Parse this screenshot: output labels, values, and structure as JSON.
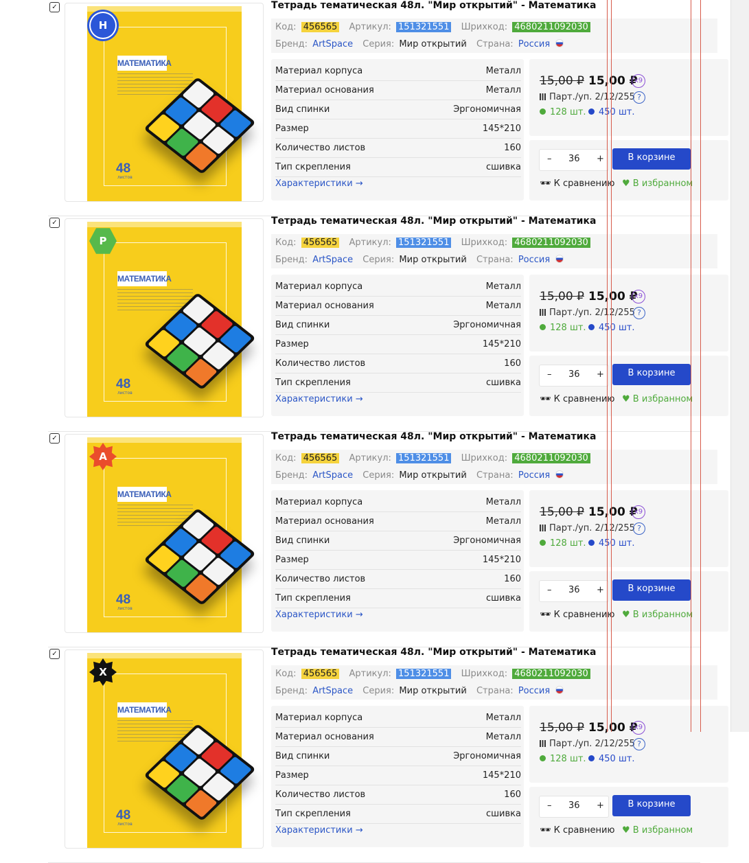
{
  "products": [
    {
      "badge": "Н",
      "badge_shape": "circle",
      "title": "Тетрадь тематическая 48л. \"Мир открытий\" - Математика",
      "code_label": "Код:",
      "code": "456565",
      "article_label": "Артикул:",
      "article": "151321551",
      "barcode_label": "Шрихкод:",
      "barcode": "4680211092030",
      "brand_label": "Бренд:",
      "brand": "ArtSpace",
      "series_label": "Серия:",
      "series": "Мир открытий",
      "country_label": "Страна:",
      "country": "Россия",
      "specs": [
        {
          "name": "Материал корпуса",
          "value": "Металл"
        },
        {
          "name": "Материал основания",
          "value": "Металл"
        },
        {
          "name": "Вид спинки",
          "value": "Эргономичная"
        },
        {
          "name": "Размер",
          "value": "145*210"
        },
        {
          "name": "Количество листов",
          "value": "160"
        },
        {
          "name": "Тип скрепления",
          "value": "сшивка"
        }
      ],
      "specs_link": "Характеристики →",
      "old_price": "15,00 ₽",
      "new_price": "15,00 ₽",
      "multiplier": "x9",
      "party": "Парт./уп. 2/12/255",
      "help": "?",
      "stock_green": "128 шт.",
      "stock_blue": "450 шт.",
      "qty": "36",
      "minus": "–",
      "plus": "+",
      "cart": "В корзине",
      "compare": "К сравнению",
      "favorite": "В избранном"
    },
    {
      "badge": "Р",
      "badge_shape": "hex",
      "title": "Тетрадь тематическая 48л. \"Мир открытий\" - Математика",
      "code_label": "Код:",
      "code": "456565",
      "article_label": "Артикул:",
      "article": "151321551",
      "barcode_label": "Шрихкод:",
      "barcode": "4680211092030",
      "brand_label": "Бренд:",
      "brand": "ArtSpace",
      "series_label": "Серия:",
      "series": "Мир открытий",
      "country_label": "Страна:",
      "country": "Россия",
      "specs": [
        {
          "name": "Материал корпуса",
          "value": "Металл"
        },
        {
          "name": "Материал основания",
          "value": "Металл"
        },
        {
          "name": "Вид спинки",
          "value": "Эргономичная"
        },
        {
          "name": "Размер",
          "value": "145*210"
        },
        {
          "name": "Количество листов",
          "value": "160"
        },
        {
          "name": "Тип скрепления",
          "value": "сшивка"
        }
      ],
      "specs_link": "Характеристики →",
      "old_price": "15,00 ₽",
      "new_price": "15,00 ₽",
      "multiplier": "x9",
      "party": "Парт./уп. 2/12/255",
      "help": "?",
      "stock_green": "128 шт.",
      "stock_blue": "450 шт.",
      "qty": "36",
      "minus": "–",
      "plus": "+",
      "cart": "В корзине",
      "compare": "К сравнению",
      "favorite": "В избранном"
    },
    {
      "badge": "А",
      "badge_shape": "star",
      "title": "Тетрадь тематическая 48л. \"Мир открытий\" - Математика",
      "code_label": "Код:",
      "code": "456565",
      "article_label": "Артикул:",
      "article": "151321551",
      "barcode_label": "Шрихкод:",
      "barcode": "4680211092030",
      "brand_label": "Бренд:",
      "brand": "ArtSpace",
      "series_label": "Серия:",
      "series": "Мир открытий",
      "country_label": "Страна:",
      "country": "Россия",
      "specs": [
        {
          "name": "Материал корпуса",
          "value": "Металл"
        },
        {
          "name": "Материал основания",
          "value": "Металл"
        },
        {
          "name": "Вид спинки",
          "value": "Эргономичная"
        },
        {
          "name": "Размер",
          "value": "145*210"
        },
        {
          "name": "Количество листов",
          "value": "160"
        },
        {
          "name": "Тип скрепления",
          "value": "сшивка"
        }
      ],
      "specs_link": "Характеристики →",
      "old_price": "15,00 ₽",
      "new_price": "15,00 ₽",
      "multiplier": "x9",
      "party": "Парт./уп. 2/12/255",
      "help": "?",
      "stock_green": "128 шт.",
      "stock_blue": "450 шт.",
      "qty": "36",
      "minus": "–",
      "plus": "+",
      "cart": "В корзине",
      "compare": "К сравнению",
      "favorite": "В избранном"
    },
    {
      "badge": "Х",
      "badge_shape": "black",
      "title": "Тетрадь тематическая 48л. \"Мир открытий\" - Математика",
      "code_label": "Код:",
      "code": "456565",
      "article_label": "Артикул:",
      "article": "151321551",
      "barcode_label": "Шрихкод:",
      "barcode": "4680211092030",
      "brand_label": "Бренд:",
      "brand": "ArtSpace",
      "series_label": "Серия:",
      "series": "Мир открытий",
      "country_label": "Страна:",
      "country": "Россия",
      "specs": [
        {
          "name": "Материал корпуса",
          "value": "Металл"
        },
        {
          "name": "Материал основания",
          "value": "Металл"
        },
        {
          "name": "Вид спинки",
          "value": "Эргономичная"
        },
        {
          "name": "Размер",
          "value": "145*210"
        },
        {
          "name": "Количество листов",
          "value": "160"
        },
        {
          "name": "Тип скрепления",
          "value": "сшивка"
        }
      ],
      "specs_link": "Характеристики →",
      "old_price": "15,00 ₽",
      "new_price": "15,00 ₽",
      "multiplier": "x9",
      "party": "Парт./уп. 2/12/255",
      "help": "?",
      "stock_green": "128 шт.",
      "stock_blue": "450 шт.",
      "qty": "36",
      "minus": "–",
      "plus": "+",
      "cart": "В корзине",
      "compare": "К сравнению",
      "favorite": "В избранном"
    }
  ],
  "cover": {
    "title": "МАТЕМАТИКА",
    "count": "48",
    "count_sub": "листов"
  },
  "checkbox_mark": "✓",
  "colors": {
    "accent": "#2549c9",
    "code_bg": "#f5d33d",
    "article_bg": "#4e8ee6",
    "barcode_bg": "#4faa3c",
    "in_stock": "#4faa3c",
    "warehouse": "#2549c9",
    "multiplier": "#8b4fd6"
  }
}
